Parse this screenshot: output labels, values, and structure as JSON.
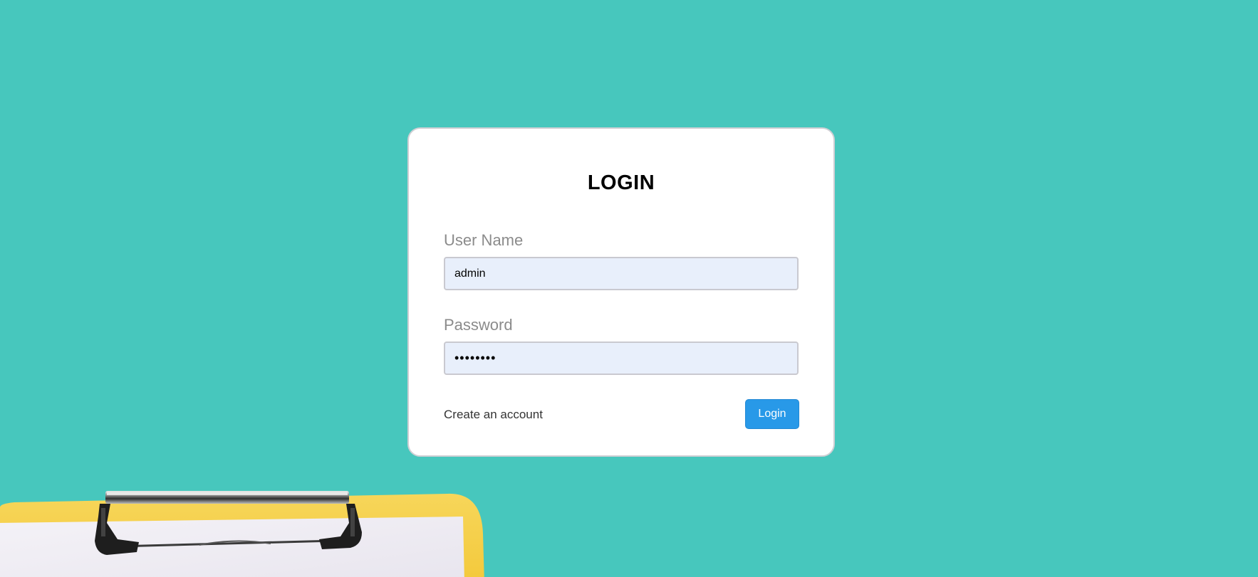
{
  "login": {
    "title": "LOGIN",
    "username_label": "User Name",
    "username_value": "admin",
    "password_label": "Password",
    "password_value": "••••••••",
    "create_account_link": "Create an account",
    "submit_label": "Login"
  },
  "colors": {
    "background": "#47c7bd",
    "card": "#ffffff",
    "input_fill": "#e8effb",
    "button": "#2899e8",
    "clipboard_board": "#f5cd45"
  },
  "decoration": {
    "icon": "clipboard-icon"
  }
}
